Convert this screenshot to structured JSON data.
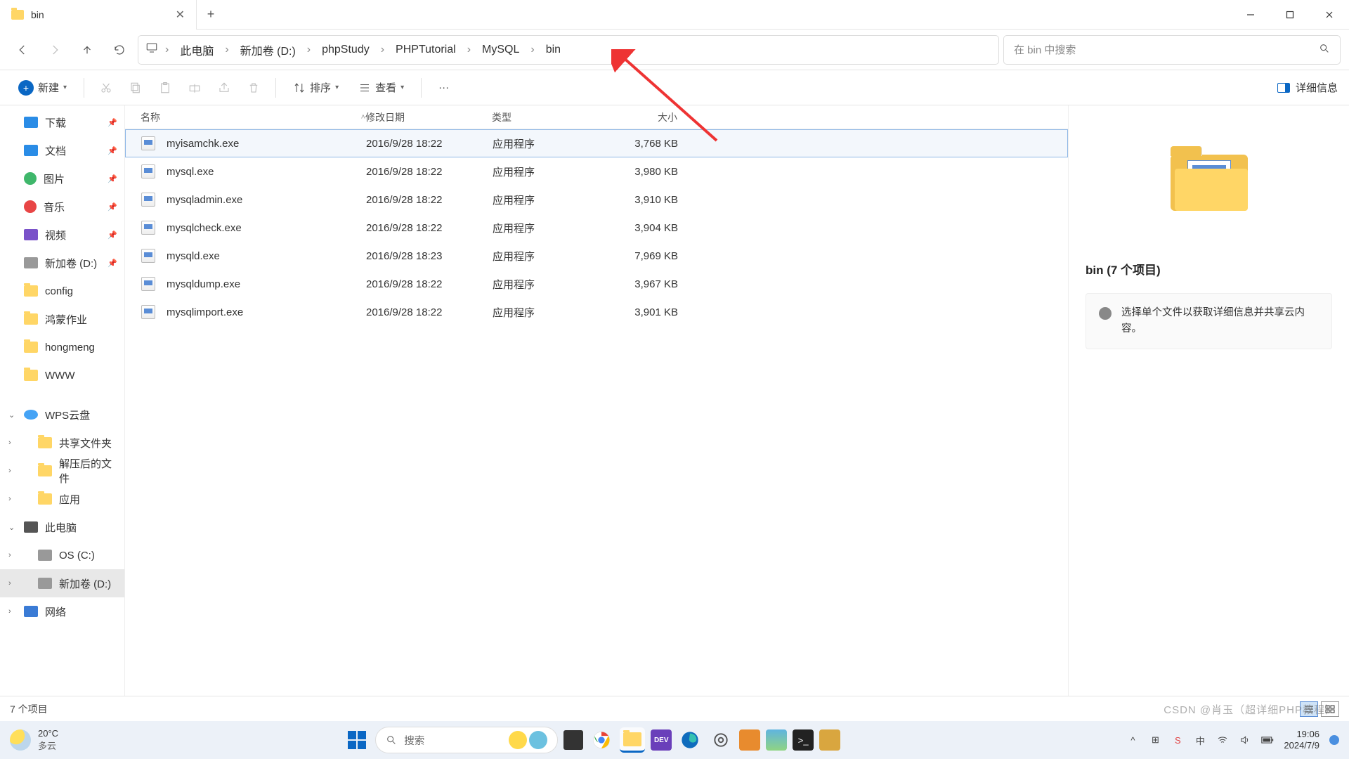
{
  "window": {
    "tab_title": "bin",
    "minimize": "—",
    "maximize": "▢",
    "close": "✕",
    "add_tab": "+"
  },
  "nav": {
    "back": "←",
    "forward": "→",
    "up": "↑",
    "refresh": "⟳"
  },
  "breadcrumb": {
    "root_icon": "🖥",
    "items": [
      "此电脑",
      "新加卷 (D:)",
      "phpStudy",
      "PHPTutorial",
      "MySQL",
      "bin"
    ]
  },
  "search": {
    "placeholder": "在 bin 中搜索"
  },
  "toolbar": {
    "new_label": "新建",
    "sort_label": "排序",
    "view_label": "查看",
    "more": "···",
    "details_label": "详细信息"
  },
  "sidebar": {
    "quick": [
      {
        "label": "下载",
        "icon": "ico-blue",
        "pinned": true
      },
      {
        "label": "文档",
        "icon": "ico-blue",
        "pinned": true
      },
      {
        "label": "图片",
        "icon": "ico-green",
        "pinned": true
      },
      {
        "label": "音乐",
        "icon": "ico-red",
        "pinned": true
      },
      {
        "label": "视频",
        "icon": "ico-purple",
        "pinned": true
      },
      {
        "label": "新加卷 (D:)",
        "icon": "ico-disk",
        "pinned": true
      },
      {
        "label": "config",
        "icon": "ico-folder",
        "pinned": false
      },
      {
        "label": "鸿蒙作业",
        "icon": "ico-folder",
        "pinned": false
      },
      {
        "label": "hongmeng",
        "icon": "ico-folder",
        "pinned": false
      },
      {
        "label": "WWW",
        "icon": "ico-folder",
        "pinned": false
      }
    ],
    "wps_label": "WPS云盘",
    "wps_children": [
      {
        "label": "共享文件夹",
        "icon": "ico-folder"
      },
      {
        "label": "解压后的文件",
        "icon": "ico-folder"
      },
      {
        "label": "应用",
        "icon": "ico-folder"
      }
    ],
    "pc_label": "此电脑",
    "pc_children": [
      {
        "label": "OS (C:)",
        "icon": "ico-disk"
      },
      {
        "label": "新加卷 (D:)",
        "icon": "ico-disk",
        "selected": true
      }
    ],
    "network_label": "网络"
  },
  "columns": {
    "name": "名称",
    "date": "修改日期",
    "type": "类型",
    "size": "大小"
  },
  "files": [
    {
      "name": "myisamchk.exe",
      "date": "2016/9/28 18:22",
      "type": "应用程序",
      "size": "3,768 KB",
      "selected": true
    },
    {
      "name": "mysql.exe",
      "date": "2016/9/28 18:22",
      "type": "应用程序",
      "size": "3,980 KB"
    },
    {
      "name": "mysqladmin.exe",
      "date": "2016/9/28 18:22",
      "type": "应用程序",
      "size": "3,910 KB"
    },
    {
      "name": "mysqlcheck.exe",
      "date": "2016/9/28 18:22",
      "type": "应用程序",
      "size": "3,904 KB"
    },
    {
      "name": "mysqld.exe",
      "date": "2016/9/28 18:23",
      "type": "应用程序",
      "size": "7,969 KB"
    },
    {
      "name": "mysqldump.exe",
      "date": "2016/9/28 18:22",
      "type": "应用程序",
      "size": "3,967 KB"
    },
    {
      "name": "mysqlimport.exe",
      "date": "2016/9/28 18:22",
      "type": "应用程序",
      "size": "3,901 KB"
    }
  ],
  "details": {
    "title": "bin (7 个项目)",
    "hint": "选择单个文件以获取详细信息并共享云内容。"
  },
  "status": {
    "text": "7 个项目"
  },
  "taskbar": {
    "weather_temp": "20°C",
    "weather_desc": "多云",
    "search_placeholder": "搜索",
    "time": "19:06",
    "date": "2024/7/9"
  },
  "watermark": "CSDN @肖玉（超详细PHP教程）"
}
